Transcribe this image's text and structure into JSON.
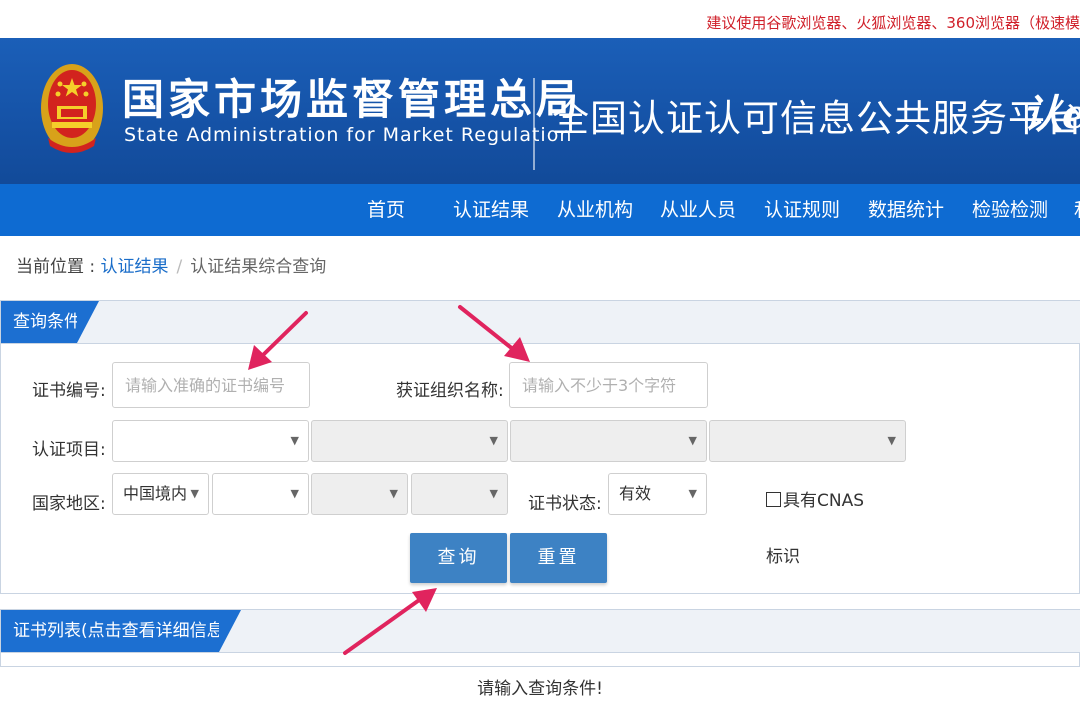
{
  "topbar": {
    "browser_notice": "建议使用谷歌浏览器、火狐浏览器、360浏览器（极速模"
  },
  "header": {
    "org_name_cn": "国家市场监督管理总局",
    "org_name_en": "State Administration  for  Market Regulation",
    "platform_title": "全国认证认可信息公共服务平台",
    "logo_text": "认e"
  },
  "nav": {
    "items": [
      "首页",
      "认证结果",
      "从业机构",
      "从业人员",
      "认证规则",
      "数据统计",
      "检验检测",
      "和"
    ]
  },
  "breadcrumb": {
    "prefix": "当前位置 : ",
    "link": "认证结果",
    "separator": "/",
    "current": "认证结果综合查询"
  },
  "query_panel": {
    "title": "查询条件",
    "cert_no_label": "证书编号:",
    "cert_no_placeholder": "请输入准确的证书编号",
    "org_name_label": "获证组织名称:",
    "org_name_placeholder": "请输入不少于3个字符",
    "project_label": "认证项目:",
    "region_label": "国家地区:",
    "region_value": "中国境内",
    "status_label": "证书状态:",
    "status_value": "有效",
    "cnas_label": "具有CNAS",
    "cnas_label_2": "标识",
    "search_button": "查询",
    "reset_button": "重置"
  },
  "list_panel": {
    "title": "证书列表(点击查看详细信息)",
    "empty_message": "请输入查询条件!"
  },
  "colors": {
    "header_blue": "#1552a6",
    "nav_blue": "#0e6bd2",
    "button_blue": "#3d82c4",
    "notice_red": "#d0202a",
    "annotation_arrow": "#e0245e"
  }
}
